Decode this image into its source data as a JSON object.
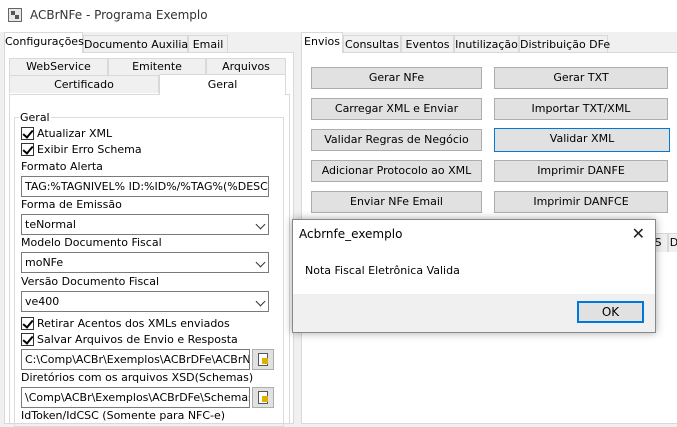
{
  "window": {
    "title": "ACBrNFe - Programa Exemplo"
  },
  "left_tabs": [
    "Configurações",
    "Documento Auxiliar",
    "Email"
  ],
  "left_subtabs_row1": [
    "WebService",
    "Emitente",
    "Arquivos"
  ],
  "left_subtabs_row2": [
    "Certificado",
    "Geral"
  ],
  "geral": {
    "group_label": "Geral",
    "atualizar_xml": "Atualizar XML",
    "exibir_erro": "Exibir Erro Schema",
    "formato_alerta_label": "Formato Alerta",
    "formato_alerta_value": "TAG:%TAGNIVEL% ID:%ID%/%TAG%(%DESCRI",
    "forma_emissao_label": "Forma de Emissão",
    "forma_emissao_value": "teNormal",
    "modelo_label": "Modelo Documento Fiscal",
    "modelo_value": "moNFe",
    "versao_label": "Versão Documento Fiscal",
    "versao_value": "ve400",
    "retirar_acentos": "Retirar Acentos dos XMLs enviados",
    "salvar_arquivos": "Salvar Arquivos de Envio e Resposta",
    "path_value": "C:\\Comp\\ACBr\\Exemplos\\ACBrDFe\\ACBrNFe\\D",
    "diretorios_label": "Diretórios com os arquivos XSD(Schemas)",
    "schemas_value": "\\Comp\\ACBr\\Exemplos\\ACBrDFe\\Schemas\\NFe",
    "idtoken_label": "IdToken/IdCSC (Somente para NFC-e)"
  },
  "right_tabs": [
    "Envios",
    "Consultas",
    "Eventos",
    "Inutilização",
    "Distribuição DFe"
  ],
  "buttons": {
    "gerar_nfe": "Gerar NFe",
    "gerar_txt": "Gerar TXT",
    "carregar_xml": "Carregar XML e Enviar",
    "importar_txt": "Importar TXT/XML",
    "validar_regras": "Validar Regras de Negócio",
    "validar_xml": "Validar XML",
    "adicionar_protocolo": "Adicionar Protocolo ao XML",
    "imprimir_danfe": "Imprimir DANFE",
    "enviar_email": "Enviar NFe Email",
    "imprimir_danfce": "Imprimir DANFCE"
  },
  "lower_tab_fragments": [
    "S",
    "D"
  ],
  "dialog": {
    "title": "Acbrnfe_exemplo",
    "message": "Nota Fiscal Eletrônica Valida",
    "ok": "OK",
    "close_icon": "close-icon"
  }
}
